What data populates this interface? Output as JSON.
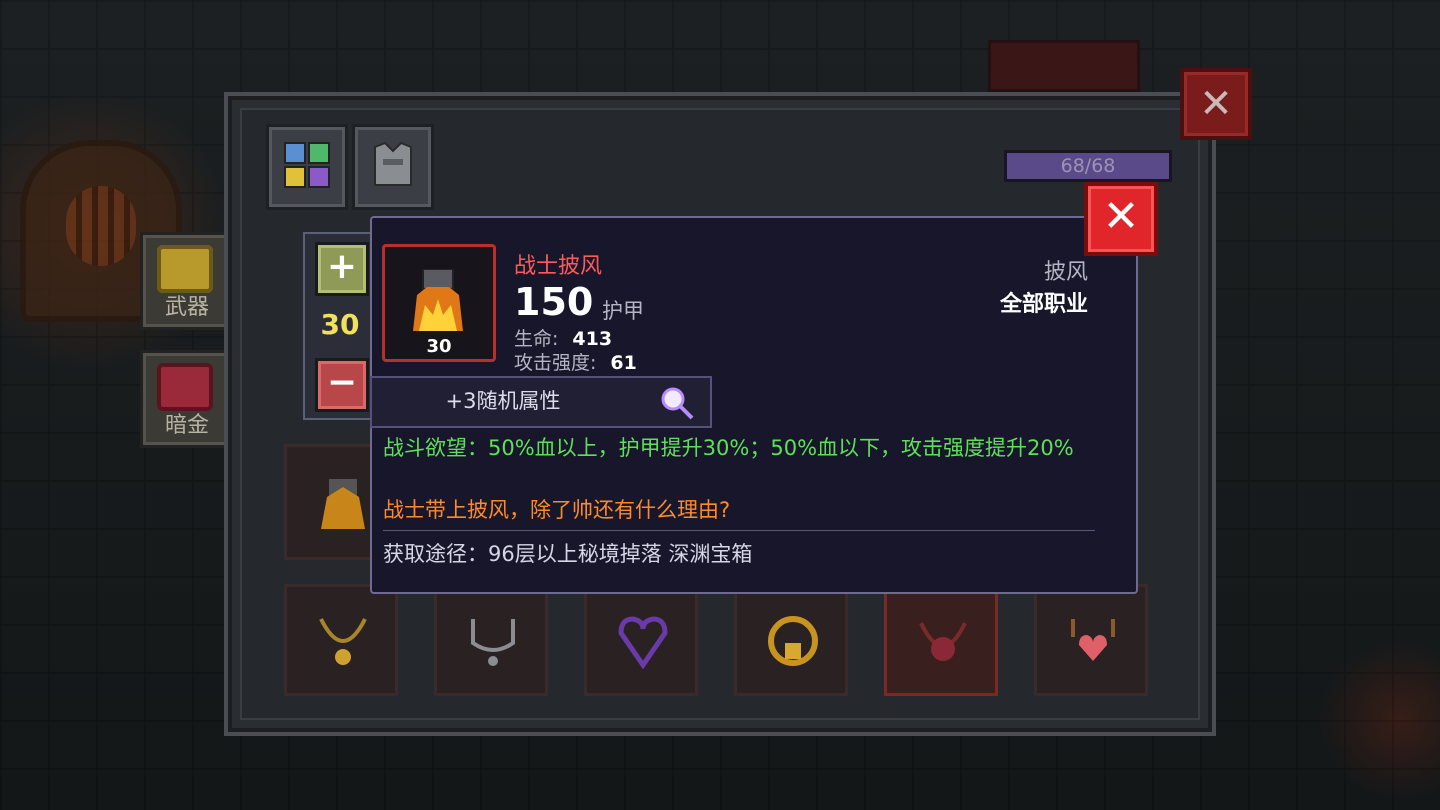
{
  "side_buttons": [
    {
      "label": "武器",
      "icon": "sword-icon"
    },
    {
      "label": "暗金",
      "icon": "treasure-chest-icon"
    }
  ],
  "hp": {
    "text": "68/68",
    "fraction": 1.0
  },
  "counter": {
    "value": "30"
  },
  "tooltip": {
    "name": "战士披风",
    "value": "150",
    "value_unit": "护甲",
    "stats": [
      {
        "label": "生命:",
        "value": "413"
      },
      {
        "label": "攻击强度:",
        "value": "61"
      }
    ],
    "item_type": "披风",
    "item_class": "全部职业",
    "item_level": "30",
    "random_attr": "+3随机属性",
    "effect": "战斗欲望：50%血以上，护甲提升30%；50%血以下，攻击强度提升20%",
    "flavor": "战士带上披风，除了帅还有什么理由?",
    "source": "获取途径：96层以上秘境掉落 深渊宝箱"
  },
  "colors": {
    "name": "#ff5a5a",
    "effect": "#5fe05a",
    "flavor": "#ff8a2a",
    "close": "#e0262a"
  }
}
